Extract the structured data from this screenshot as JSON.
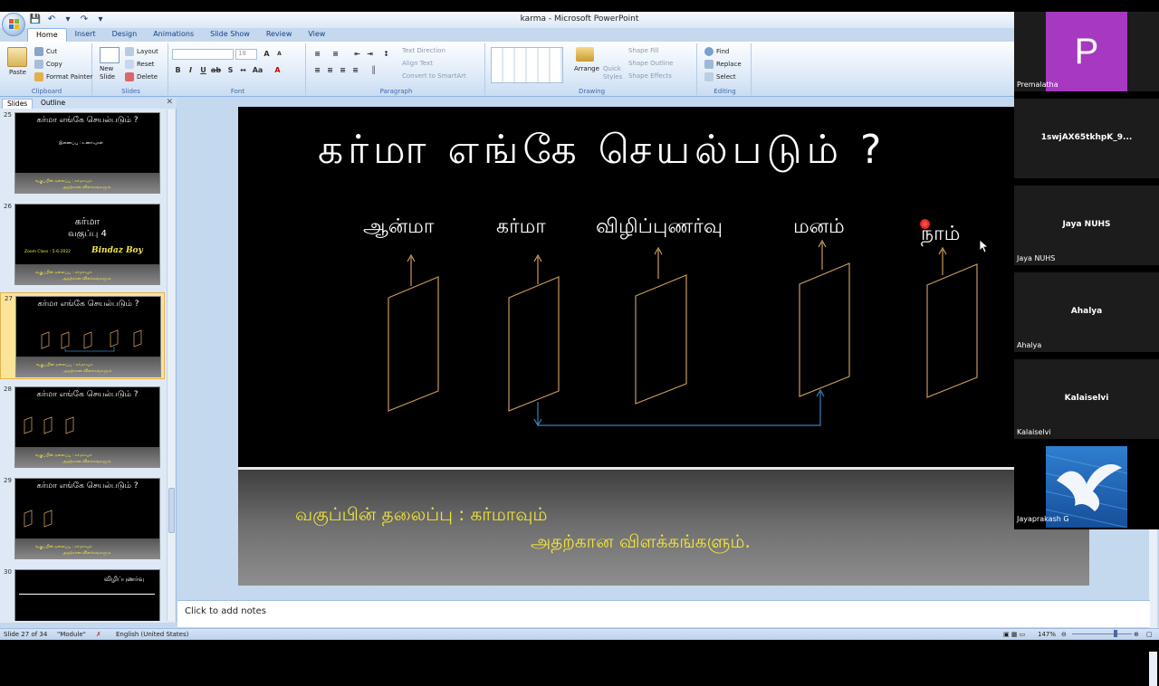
{
  "window": {
    "title": "karma - Microsoft PowerPoint"
  },
  "ribbon": {
    "tabs": [
      "Home",
      "Insert",
      "Design",
      "Animations",
      "Slide Show",
      "Review",
      "View"
    ],
    "clipboard": {
      "label": "Clipboard",
      "paste": "Paste",
      "cut": "Cut",
      "copy": "Copy",
      "format_painter": "Format Painter"
    },
    "slides": {
      "label": "Slides",
      "new_slide": "New Slide",
      "layout": "Layout",
      "reset": "Reset",
      "delete": "Delete"
    },
    "font": {
      "label": "Font",
      "size": "18"
    },
    "paragraph": {
      "label": "Paragraph",
      "text_direction": "Text Direction",
      "align_text": "Align Text",
      "convert_smartart": "Convert to SmartArt"
    },
    "drawing": {
      "label": "Drawing",
      "arrange": "Arrange",
      "quick_styles": "Quick Styles",
      "shape_fill": "Shape Fill",
      "shape_outline": "Shape Outline",
      "shape_effects": "Shape Effects"
    },
    "editing": {
      "label": "Editing",
      "find": "Find",
      "replace": "Replace",
      "select": "Select"
    }
  },
  "panel": {
    "tabs": [
      "Slides",
      "Outline"
    ],
    "thumbnails": [
      {
        "num": "25",
        "title": "கர்மா எங்கே செயல்படும் ?",
        "sub": "இணைப்பு : உணர்வுகள்",
        "band1": "வகுப்பின் தலைப்பு : கர்மாவும்",
        "band2": "அதற்கான விளக்கங்களும்."
      },
      {
        "num": "26",
        "title": "கர்மா",
        "title2": "வகுப்பு 4",
        "zoom": "Zoom Class : 5-6-2022",
        "author": "Bindaz Boy",
        "band1": "வகுப்பின் தலைப்பு : கர்மாவும்",
        "band2": "அதற்கான விளக்கங்களும்."
      },
      {
        "num": "27",
        "title": "கர்மா எங்கே செயல்படும் ?",
        "band1": "வகுப்பின் தலைப்பு : கர்மாவும்",
        "band2": "அதற்கான விளக்கங்களும்."
      },
      {
        "num": "28",
        "title": "கர்மா எங்கே செயல்படும் ?",
        "band1": "வகுப்பின் தலைப்பு : கர்மாவும்",
        "band2": "அதற்கான விளக்கங்களும்."
      },
      {
        "num": "29",
        "title": "கர்மா எங்கே செயல்படும் ?",
        "band1": "வகுப்பின் தலைப்பு : கர்மாவும்",
        "band2": "அதற்கான விளக்கங்களும்."
      },
      {
        "num": "30",
        "title": "விழிப்புணர்வு"
      }
    ]
  },
  "slide": {
    "title": "கர்மா எங்கே செயல்படும் ?",
    "labels": [
      "ஆன்மா",
      "கர்மா",
      "விழிப்புணர்வு",
      "மனம்",
      "நாம்"
    ],
    "footer_line1": "வகுப்பின் தலைப்பு : கர்மாவும்",
    "footer_line2": "அதற்கான  விளக்கங்களும்."
  },
  "notes": {
    "placeholder": "Click to add notes"
  },
  "status": {
    "slide": "Slide 27 of 34",
    "theme": "\"Module\"",
    "language": "English (United States)",
    "zoom": "147%"
  },
  "participants": [
    {
      "name": "Premalatha",
      "initial": "P",
      "type": "avatar"
    },
    {
      "name": "",
      "display": "1swjAX65tkhpK_9...",
      "type": "name"
    },
    {
      "name": "Jaya NUHS",
      "display": "Jaya NUHS",
      "type": "name"
    },
    {
      "name": "Ahalya",
      "display": "Ahalya",
      "type": "name"
    },
    {
      "name": "Kalaiselvi",
      "display": "Kalaiselvi",
      "type": "name"
    },
    {
      "name": "Jayaprakash G",
      "type": "photo"
    }
  ],
  "colors": {
    "avatar": "#a639c0",
    "footer_text": "#f1e43a",
    "frame_orange": "#c89a5a",
    "connector_blue": "#3b7fb3"
  }
}
